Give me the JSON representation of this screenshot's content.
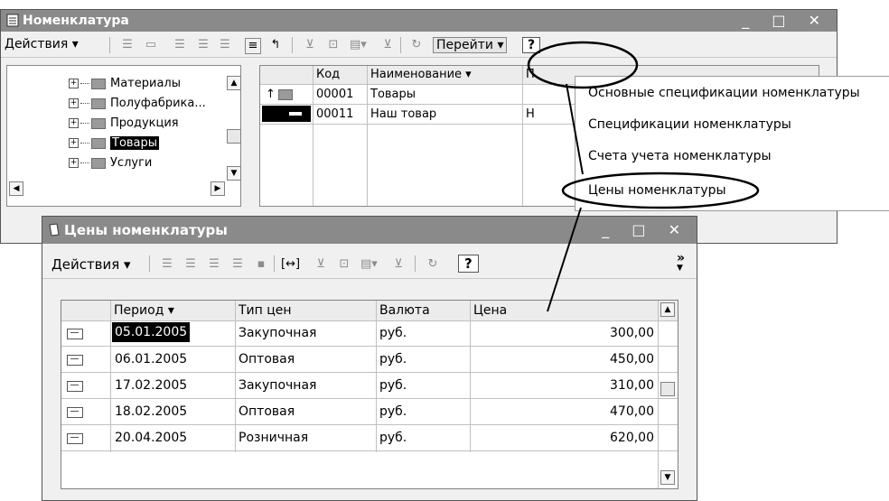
{
  "nomen": {
    "title": "Номенклатура",
    "actions": "Действия ▾",
    "goto": "Перейти ▾",
    "help": "?",
    "tree": [
      "Материалы",
      "Полуфабрика...",
      "Продукция",
      "Товары",
      "Услуги"
    ],
    "columns": [
      "Код",
      "Наименование ▾",
      "П"
    ],
    "rows": [
      {
        "code": "00001",
        "name": "Товары",
        "p": ""
      },
      {
        "code": "00011",
        "name": "Наш товар",
        "p": "Н"
      }
    ]
  },
  "menu": {
    "items": [
      "Основные спецификации номенклатуры",
      "Спецификации номенклатуры",
      "Счета учета номенклатуры",
      "Цены номенклатуры"
    ]
  },
  "prices": {
    "title": "Цены номенклатуры",
    "actions": "Действия ▾",
    "help": "?",
    "more": "»",
    "columns": [
      "Период ▾",
      "Тип цен",
      "Валюта",
      "Цена"
    ],
    "rows": [
      {
        "period": "05.01.2005",
        "type": "Закупочная",
        "cur": "руб.",
        "price": "300,00"
      },
      {
        "period": "06.01.2005",
        "type": "Оптовая",
        "cur": "руб.",
        "price": "450,00"
      },
      {
        "period": "17.02.2005",
        "type": "Закупочная",
        "cur": "руб.",
        "price": "310,00"
      },
      {
        "period": "18.02.2005",
        "type": "Оптовая",
        "cur": "руб.",
        "price": "470,00"
      },
      {
        "period": "20.04.2005",
        "type": "Розничная",
        "cur": "руб.",
        "price": "620,00"
      }
    ]
  },
  "window_controls": "_ □ ✕",
  "colors": {
    "titlebar": "#8a8a8a",
    "selection": "#000000",
    "highlight_ellipse": "#000000"
  }
}
